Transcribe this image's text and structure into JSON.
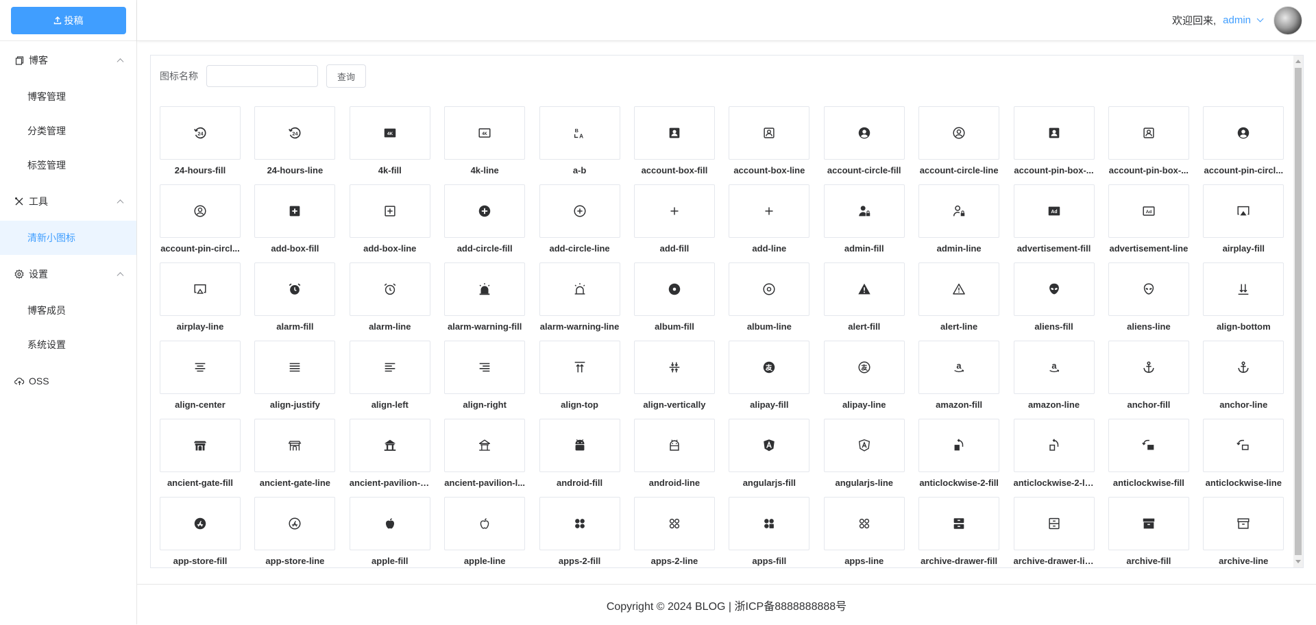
{
  "sidebar": {
    "publish_label": "投稿",
    "groups": [
      {
        "label": "博客",
        "icon": "document-copy-icon",
        "items": [
          {
            "label": "博客管理"
          },
          {
            "label": "分类管理"
          },
          {
            "label": "标签管理"
          }
        ]
      },
      {
        "label": "工具",
        "icon": "tools-icon",
        "items": [
          {
            "label": "清新小图标",
            "active": true
          }
        ]
      },
      {
        "label": "设置",
        "icon": "gear-icon",
        "items": [
          {
            "label": "博客成员"
          },
          {
            "label": "系统设置"
          }
        ]
      },
      {
        "label": "OSS",
        "icon": "cloud-upload-icon",
        "items": []
      }
    ]
  },
  "header": {
    "welcome": "欢迎回来,",
    "username": "admin"
  },
  "search": {
    "label": "图标名称",
    "input_value": "",
    "button_label": "查询"
  },
  "icons": [
    {
      "name": "24-hours-fill",
      "glyph": "24h"
    },
    {
      "name": "24-hours-line",
      "glyph": "24h"
    },
    {
      "name": "4k-fill",
      "glyph": "4kf"
    },
    {
      "name": "4k-line",
      "glyph": "4kl"
    },
    {
      "name": "a-b",
      "glyph": "ab"
    },
    {
      "name": "account-box-fill",
      "glyph": "accboxf"
    },
    {
      "name": "account-box-line",
      "glyph": "accboxl"
    },
    {
      "name": "account-circle-fill",
      "glyph": "acccirf"
    },
    {
      "name": "account-circle-line",
      "glyph": "acccirl"
    },
    {
      "name": "account-pin-box-...",
      "glyph": "accboxf"
    },
    {
      "name": "account-pin-box-...",
      "glyph": "accboxl"
    },
    {
      "name": "account-pin-circl...",
      "glyph": "acccirf"
    },
    {
      "name": "account-pin-circl...",
      "glyph": "acccirl"
    },
    {
      "name": "add-box-fill",
      "glyph": "addboxf"
    },
    {
      "name": "add-box-line",
      "glyph": "addboxl"
    },
    {
      "name": "add-circle-fill",
      "glyph": "addcirf"
    },
    {
      "name": "add-circle-line",
      "glyph": "addcirl"
    },
    {
      "name": "add-fill",
      "glyph": "plus"
    },
    {
      "name": "add-line",
      "glyph": "plus"
    },
    {
      "name": "admin-fill",
      "glyph": "adminf"
    },
    {
      "name": "admin-line",
      "glyph": "adminl"
    },
    {
      "name": "advertisement-fill",
      "glyph": "adf"
    },
    {
      "name": "advertisement-line",
      "glyph": "adl"
    },
    {
      "name": "airplay-fill",
      "glyph": "airplayf"
    },
    {
      "name": "airplay-line",
      "glyph": "airplayl"
    },
    {
      "name": "alarm-fill",
      "glyph": "alarmf"
    },
    {
      "name": "alarm-line",
      "glyph": "alarml"
    },
    {
      "name": "alarm-warning-fill",
      "glyph": "sirenf"
    },
    {
      "name": "alarm-warning-line",
      "glyph": "sirenl"
    },
    {
      "name": "album-fill",
      "glyph": "albumf"
    },
    {
      "name": "album-line",
      "glyph": "albuml"
    },
    {
      "name": "alert-fill",
      "glyph": "alertf"
    },
    {
      "name": "alert-line",
      "glyph": "alertl"
    },
    {
      "name": "aliens-fill",
      "glyph": "alienf"
    },
    {
      "name": "aliens-line",
      "glyph": "alienl"
    },
    {
      "name": "align-bottom",
      "glyph": "alignbottom"
    },
    {
      "name": "align-center",
      "glyph": "aligncenter"
    },
    {
      "name": "align-justify",
      "glyph": "alignjustify"
    },
    {
      "name": "align-left",
      "glyph": "alignleft"
    },
    {
      "name": "align-right",
      "glyph": "alignright"
    },
    {
      "name": "align-top",
      "glyph": "aligntop"
    },
    {
      "name": "align-vertically",
      "glyph": "alignvert"
    },
    {
      "name": "alipay-fill",
      "glyph": "alipayf"
    },
    {
      "name": "alipay-line",
      "glyph": "alipayl"
    },
    {
      "name": "amazon-fill",
      "glyph": "amazon"
    },
    {
      "name": "amazon-line",
      "glyph": "amazon"
    },
    {
      "name": "anchor-fill",
      "glyph": "anchor"
    },
    {
      "name": "anchor-line",
      "glyph": "anchor"
    },
    {
      "name": "ancient-gate-fill",
      "glyph": "gatef"
    },
    {
      "name": "ancient-gate-line",
      "glyph": "gatel"
    },
    {
      "name": "ancient-pavilion-fill",
      "glyph": "pavilionf"
    },
    {
      "name": "ancient-pavilion-l...",
      "glyph": "pavilionl"
    },
    {
      "name": "android-fill",
      "glyph": "androidf"
    },
    {
      "name": "android-line",
      "glyph": "androidl"
    },
    {
      "name": "angularjs-fill",
      "glyph": "angularf"
    },
    {
      "name": "angularjs-line",
      "glyph": "angularl"
    },
    {
      "name": "anticlockwise-2-fill",
      "glyph": "acw2f"
    },
    {
      "name": "anticlockwise-2-li...",
      "glyph": "acw2l"
    },
    {
      "name": "anticlockwise-fill",
      "glyph": "acwf"
    },
    {
      "name": "anticlockwise-line",
      "glyph": "acwl"
    },
    {
      "name": "app-store-fill",
      "glyph": "appstoref"
    },
    {
      "name": "app-store-line",
      "glyph": "appstorel"
    },
    {
      "name": "apple-fill",
      "glyph": "applef"
    },
    {
      "name": "apple-line",
      "glyph": "applel"
    },
    {
      "name": "apps-2-fill",
      "glyph": "apps2f"
    },
    {
      "name": "apps-2-line",
      "glyph": "apps2l"
    },
    {
      "name": "apps-fill",
      "glyph": "appsf"
    },
    {
      "name": "apps-line",
      "glyph": "appsl"
    },
    {
      "name": "archive-drawer-fill",
      "glyph": "drawerf"
    },
    {
      "name": "archive-drawer-line",
      "glyph": "drawerl"
    },
    {
      "name": "archive-fill",
      "glyph": "archivef"
    },
    {
      "name": "archive-line",
      "glyph": "archivel"
    }
  ],
  "footer": {
    "text": "Copyright © 2024 BLOG | 浙ICP备8888888888号"
  },
  "colors": {
    "accent": "#409eff",
    "active_bg": "#ecf5ff",
    "border": "#e4e7ed"
  }
}
